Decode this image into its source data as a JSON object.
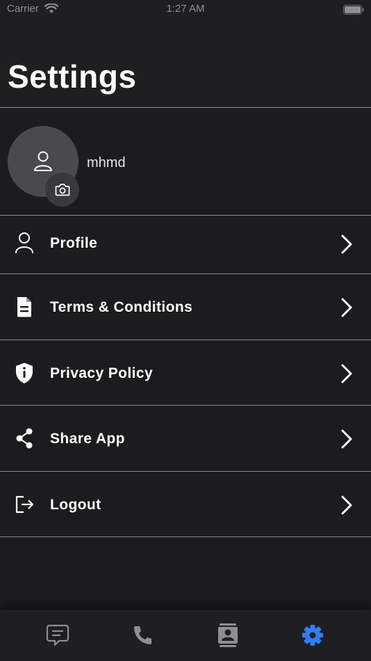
{
  "status_bar": {
    "carrier": "Carrier",
    "time": "1:27 AM"
  },
  "header": {
    "title": "Settings"
  },
  "profile_card": {
    "username": "mhmd"
  },
  "menu": {
    "items": [
      {
        "label": "Profile",
        "icon": "person-icon"
      },
      {
        "label": "Terms & Conditions",
        "icon": "document-icon"
      },
      {
        "label": "Privacy Policy",
        "icon": "shield-icon"
      },
      {
        "label": "Share App",
        "icon": "share-icon"
      },
      {
        "label": "Logout",
        "icon": "logout-icon"
      }
    ]
  },
  "tab_bar": {
    "tabs": [
      {
        "icon": "chat-icon",
        "active": false
      },
      {
        "icon": "phone-icon",
        "active": false
      },
      {
        "icon": "contacts-icon",
        "active": false
      },
      {
        "icon": "settings-gear-icon",
        "active": true
      }
    ]
  },
  "colors": {
    "background": "#1c1c1e",
    "header": "#1f1f22",
    "accent": "#2f7ef6",
    "divider": "#8a8a8e",
    "inactive_icon": "#8e8e93"
  }
}
